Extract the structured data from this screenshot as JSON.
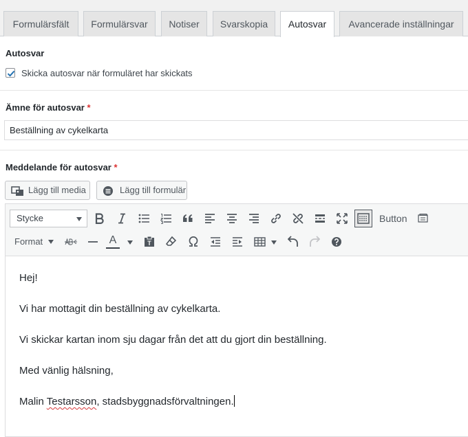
{
  "tabs": [
    {
      "label": "Formulärsfält",
      "active": false
    },
    {
      "label": "Formulärsvar",
      "active": false
    },
    {
      "label": "Notiser",
      "active": false
    },
    {
      "label": "Svarskopia",
      "active": false
    },
    {
      "label": "Autosvar",
      "active": true
    },
    {
      "label": "Avancerade inställningar",
      "active": false
    }
  ],
  "autoreply": {
    "title": "Autosvar",
    "checkbox_label": "Skicka autosvar när formuläret har skickats",
    "checked": true
  },
  "subject": {
    "label": "Ämne för autosvar",
    "required_mark": "*",
    "value": "Beställning av cykelkarta"
  },
  "message": {
    "label": "Meddelande för autosvar",
    "required_mark": "*",
    "add_media": "Lägg till media",
    "add_form": "Lägg till formulär"
  },
  "toolbar": {
    "format_select": "Stycke",
    "button_label": "Button",
    "format_menu": "Format",
    "text_color_letter": "A"
  },
  "content": {
    "line1": "Hej!",
    "line2": "Vi har mottagit din beställning av cykelkarta.",
    "line3": "Vi skickar kartan inom sju dagar från det att du gjort din beställning.",
    "line4": "Med vänlig hälsning,",
    "line5_name": "Malin",
    "line5_misspelled": "Testarsson",
    "line5_rest": ", stadsbyggnadsförvaltningen."
  },
  "colors": {
    "required": "#dc3232",
    "checkbox_check": "#2271b1",
    "text_color_bar": "#3c434a"
  }
}
